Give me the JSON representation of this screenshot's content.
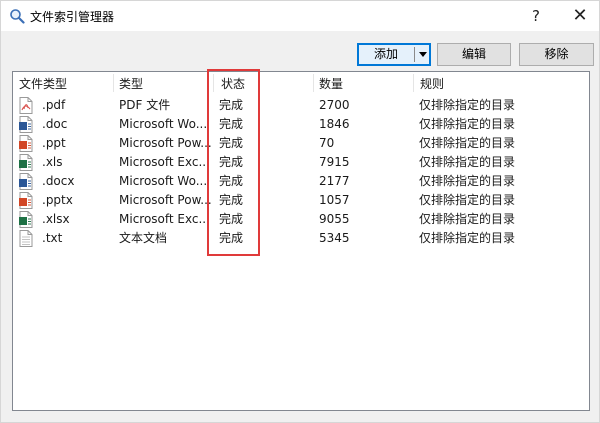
{
  "window": {
    "title": "文件索引管理器",
    "help_label": "?",
    "close_label": "✕"
  },
  "toolbar": {
    "add_label": "添加",
    "edit_label": "编辑",
    "remove_label": "移除"
  },
  "list": {
    "columns": [
      "文件类型",
      "类型",
      "状态",
      "数量",
      "规则"
    ],
    "rows": [
      {
        "ext": ".pdf",
        "type": "PDF 文件",
        "status": "完成",
        "count": "2700",
        "rule": "仅排除指定的目录",
        "icon": "pdf-file-icon",
        "color": "#d9534f"
      },
      {
        "ext": ".doc",
        "type": "Microsoft Wo...",
        "status": "完成",
        "count": "1846",
        "rule": "仅排除指定的目录",
        "icon": "word-file-icon",
        "color": "#2b5797"
      },
      {
        "ext": ".ppt",
        "type": "Microsoft Pow...",
        "status": "完成",
        "count": "70",
        "rule": "仅排除指定的目录",
        "icon": "powerpoint-file-icon",
        "color": "#d24726"
      },
      {
        "ext": ".xls",
        "type": "Microsoft Exc...",
        "status": "完成",
        "count": "7915",
        "rule": "仅排除指定的目录",
        "icon": "excel-file-icon",
        "color": "#1e7145"
      },
      {
        "ext": ".docx",
        "type": "Microsoft Wo...",
        "status": "完成",
        "count": "2177",
        "rule": "仅排除指定的目录",
        "icon": "word-file-icon",
        "color": "#2b5797"
      },
      {
        "ext": ".pptx",
        "type": "Microsoft Pow...",
        "status": "完成",
        "count": "1057",
        "rule": "仅排除指定的目录",
        "icon": "powerpoint-file-icon",
        "color": "#d24726"
      },
      {
        "ext": ".xlsx",
        "type": "Microsoft Exc...",
        "status": "完成",
        "count": "9055",
        "rule": "仅排除指定的目录",
        "icon": "excel-file-icon",
        "color": "#1e7145"
      },
      {
        "ext": ".txt",
        "type": "文本文档",
        "status": "完成",
        "count": "5345",
        "rule": "仅排除指定的目录",
        "icon": "text-file-icon",
        "color": "#9a9a9a"
      }
    ]
  },
  "highlight_color": "#e03a3a"
}
